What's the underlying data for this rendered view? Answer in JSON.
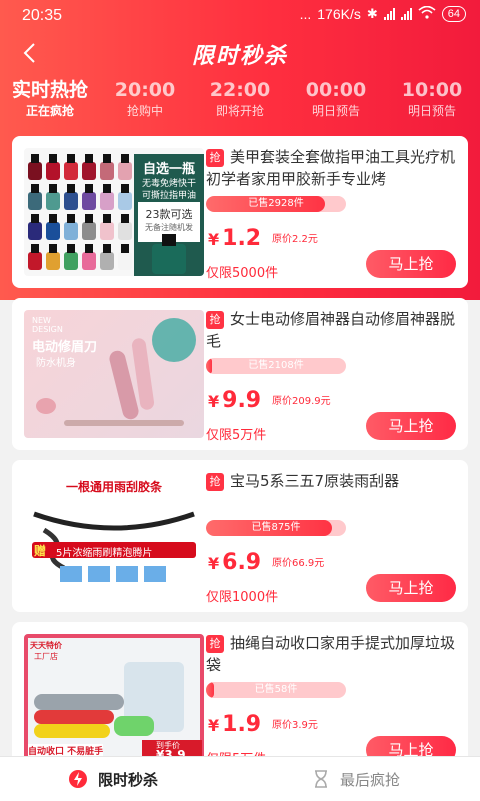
{
  "statusbar": {
    "time": "20:35",
    "dots": "...",
    "speed": "176K/s",
    "battery": "64"
  },
  "header": {
    "back_icon": "chevron-left-icon",
    "title": "限时秒杀"
  },
  "session_tabs": [
    {
      "time": "实时热抢",
      "status": "正在疯抢"
    },
    {
      "time": "20:00",
      "status": "抢购中"
    },
    {
      "time": "22:00",
      "status": "即将开抢"
    },
    {
      "time": "00:00",
      "status": "明日预告"
    },
    {
      "time": "10:00",
      "status": "明日预告"
    }
  ],
  "products": [
    {
      "tag": "抢",
      "title": "美甲套装全套做指甲油工具光疗机初学者家用甲胶新手专业烤",
      "sold": "已售2928件",
      "sold_fraction": 0.85,
      "yen": "¥",
      "price": "1.2",
      "original": "原价2.2元",
      "limit": "仅限5000件",
      "buy": "马上抢",
      "thumb": {
        "l1": "自选一瓶",
        "l2": "无毒免烤快干",
        "l3": "可撕拉指甲油",
        "l4": "23款可选",
        "l5": "无备注随机发"
      }
    },
    {
      "tag": "抢",
      "title": "女士电动修眉神器自动修眉神器脱毛",
      "sold": "已售2108件",
      "sold_fraction": 0.04,
      "yen": "¥",
      "price": "9.9",
      "original": "原价209.9元",
      "limit": "仅限5万件",
      "buy": "马上抢",
      "thumb": {
        "l1": "NEW",
        "l2": "DESIGN",
        "l3": "电动修眉刀",
        "l4": "防水机身"
      }
    },
    {
      "tag": "抢",
      "title": "宝马5系三五7原装雨刮器",
      "sold": "已售875件",
      "sold_fraction": 0.9,
      "yen": "¥",
      "price": "6.9",
      "original": "原价66.9元",
      "limit": "仅限1000件",
      "buy": "马上抢",
      "thumb": {
        "l1": "一根通用雨刮胶条",
        "l2": "赠",
        "l3": "5片浓缩雨刷精泡腾片"
      }
    },
    {
      "tag": "抢",
      "title": "抽绳自动收口家用手提式加厚垃圾袋",
      "sold": "已售58件",
      "sold_fraction": 0.06,
      "yen": "¥",
      "price": "1.9",
      "original": "原价3.9元",
      "limit": "仅限5万件",
      "buy": "马上抢",
      "thumb": {
        "l1": "天天特价",
        "l2": "工厂店",
        "l3": "自动收口 不易脏手",
        "l4": "到手价",
        "l5": "¥3.9"
      }
    }
  ],
  "tabbar": [
    {
      "label": "限时秒杀",
      "icon": "lightning-icon",
      "active": true
    },
    {
      "label": "最后疯抢",
      "icon": "hourglass-icon",
      "active": false
    }
  ],
  "colors": {
    "accent": "#ff2a3a",
    "header_start": "#ff5a4e",
    "header_end": "#f21b3c"
  }
}
